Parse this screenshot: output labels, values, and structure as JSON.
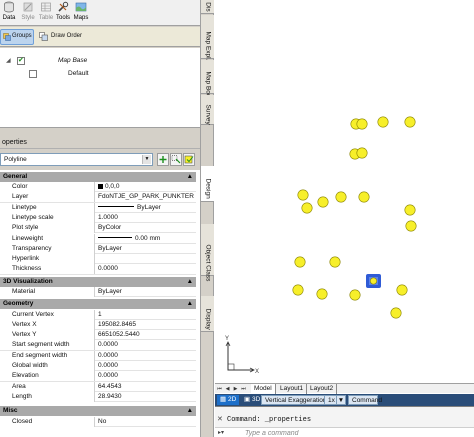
{
  "ribbon": {
    "items": [
      {
        "label": "Data",
        "icon": "data-icon",
        "enabled": true
      },
      {
        "label": "Style",
        "icon": "style-icon",
        "enabled": false
      },
      {
        "label": "Table",
        "icon": "table-icon",
        "enabled": false
      },
      {
        "label": "Tools",
        "icon": "tools-icon",
        "enabled": true
      },
      {
        "label": "Maps",
        "icon": "maps-icon",
        "enabled": true
      }
    ]
  },
  "layer_toolbar": {
    "groups_label": "Groups",
    "draw_order_label": "Draw Order"
  },
  "layer_tree": {
    "map_base": "Map Base",
    "default": "Default"
  },
  "properties": {
    "header": "operties",
    "object_type": "Polyline",
    "categories": {
      "general": {
        "title": "General",
        "rows": [
          {
            "key": "Color",
            "value": "0,0,0"
          },
          {
            "key": "Layer",
            "value": "FdoNTJE_GP_PARK_PUNKTER"
          },
          {
            "key": "Linetype",
            "value": "ByLayer"
          },
          {
            "key": "Linetype scale",
            "value": "1.0000"
          },
          {
            "key": "Plot style",
            "value": "ByColor"
          },
          {
            "key": "Lineweight",
            "value": "0.00 mm"
          },
          {
            "key": "Transparency",
            "value": "ByLayer"
          },
          {
            "key": "Hyperlink",
            "value": ""
          },
          {
            "key": "Thickness",
            "value": "0.0000"
          }
        ]
      },
      "visualization": {
        "title": "3D Visualization",
        "rows": [
          {
            "key": "Material",
            "value": "ByLayer"
          }
        ]
      },
      "geometry": {
        "title": "Geometry",
        "rows": [
          {
            "key": "Current Vertex",
            "value": "1"
          },
          {
            "key": "Vertex X",
            "value": "195082.8465"
          },
          {
            "key": "Vertex Y",
            "value": "6651052.5440"
          },
          {
            "key": "Start segment width",
            "value": "0.0000"
          },
          {
            "key": "End segment width",
            "value": "0.0000"
          },
          {
            "key": "Global width",
            "value": "0.0000"
          },
          {
            "key": "Elevation",
            "value": "0.0000"
          },
          {
            "key": "Area",
            "value": "64.4543"
          },
          {
            "key": "Length",
            "value": "28.9430"
          }
        ]
      },
      "misc": {
        "title": "Misc",
        "rows": [
          {
            "key": "Closed",
            "value": "No"
          }
        ]
      }
    }
  },
  "side_tabs": [
    "Dis",
    "Map Expl...",
    "Map Book",
    "Survey",
    "Design",
    "Object Class",
    "Display"
  ],
  "layout_tabs": [
    "Model",
    "Layout1",
    "Layout2"
  ],
  "status_bar": {
    "btn_2d": "2D",
    "btn_3d": "3D",
    "vertical_exaggeration": "Vertical Exaggeration:",
    "exaggeration_value": "1x",
    "command": "Command"
  },
  "command_line": {
    "history": "Command:  _properties",
    "placeholder": "Type a command"
  },
  "colors": {
    "point_fill": "#f7ef2a",
    "point_stroke": "#8a8400",
    "selected_fill": "#2f5bd6",
    "status_bar": "#2a4d79"
  }
}
